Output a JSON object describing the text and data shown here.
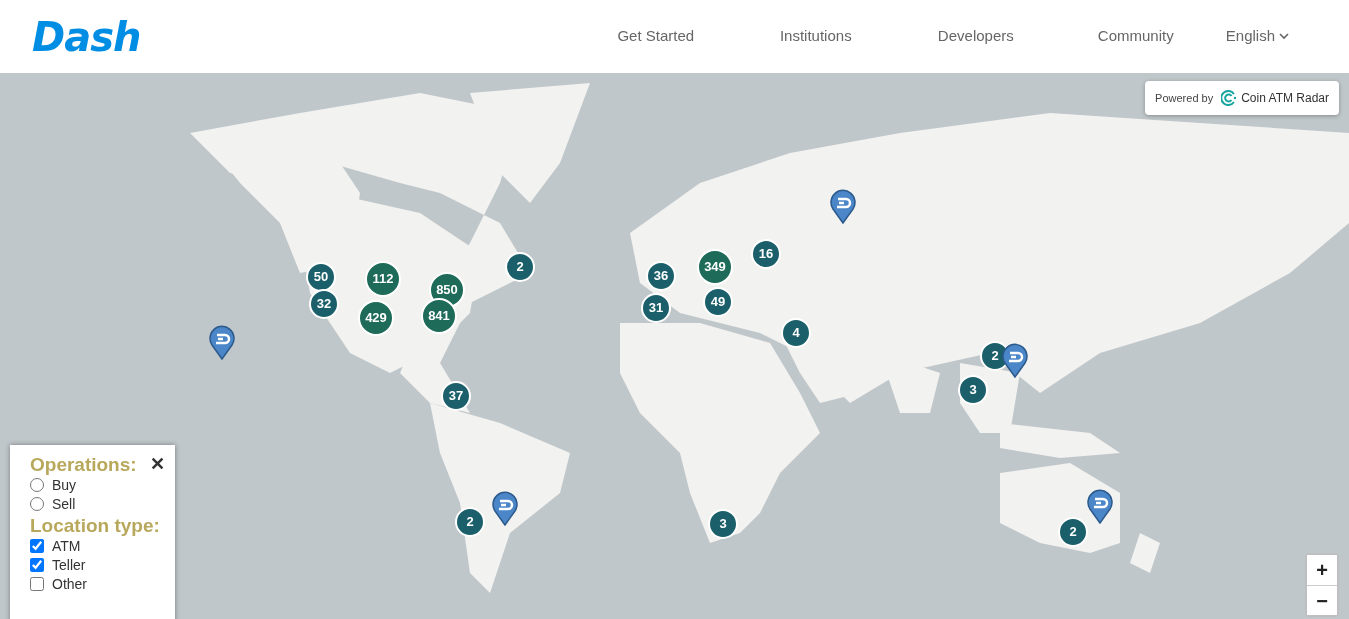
{
  "header": {
    "logo": "Dash",
    "nav": [
      {
        "label": "Get Started"
      },
      {
        "label": "Institutions"
      },
      {
        "label": "Developers"
      },
      {
        "label": "Community"
      }
    ],
    "language": "English"
  },
  "map": {
    "attribution": {
      "prefix": "Powered by",
      "brand": "Coin ATM Radar"
    },
    "markers": [
      {
        "kind": "small",
        "count": "50"
      },
      {
        "kind": "small",
        "count": "32"
      },
      {
        "kind": "large",
        "count": "112"
      },
      {
        "kind": "large",
        "count": "429"
      },
      {
        "kind": "large",
        "count": "850"
      },
      {
        "kind": "large",
        "count": "841"
      },
      {
        "kind": "small",
        "count": "2"
      },
      {
        "kind": "small",
        "count": "37"
      },
      {
        "kind": "small",
        "count": "2"
      },
      {
        "kind": "small",
        "count": "36"
      },
      {
        "kind": "small",
        "count": "31"
      },
      {
        "kind": "large",
        "count": "349"
      },
      {
        "kind": "small",
        "count": "49"
      },
      {
        "kind": "small",
        "count": "16"
      },
      {
        "kind": "small",
        "count": "4"
      },
      {
        "kind": "small",
        "count": "3"
      },
      {
        "kind": "small",
        "count": "2"
      },
      {
        "kind": "small",
        "count": "3"
      },
      {
        "kind": "small",
        "count": "2"
      },
      {
        "kind": "pin"
      },
      {
        "kind": "pin"
      },
      {
        "kind": "pin"
      },
      {
        "kind": "pin"
      },
      {
        "kind": "pin"
      }
    ],
    "zoom": {
      "in": "+",
      "out": "−"
    }
  },
  "filters": {
    "close": "✕",
    "groups": [
      {
        "title": "Operations:",
        "kind": "radio",
        "options": [
          {
            "label": "Buy",
            "checked": false
          },
          {
            "label": "Sell",
            "checked": false
          }
        ]
      },
      {
        "title": "Location type:",
        "kind": "checkbox",
        "options": [
          {
            "label": "ATM",
            "checked": true
          },
          {
            "label": "Teller",
            "checked": true
          },
          {
            "label": "Other",
            "checked": false
          }
        ]
      }
    ]
  }
}
